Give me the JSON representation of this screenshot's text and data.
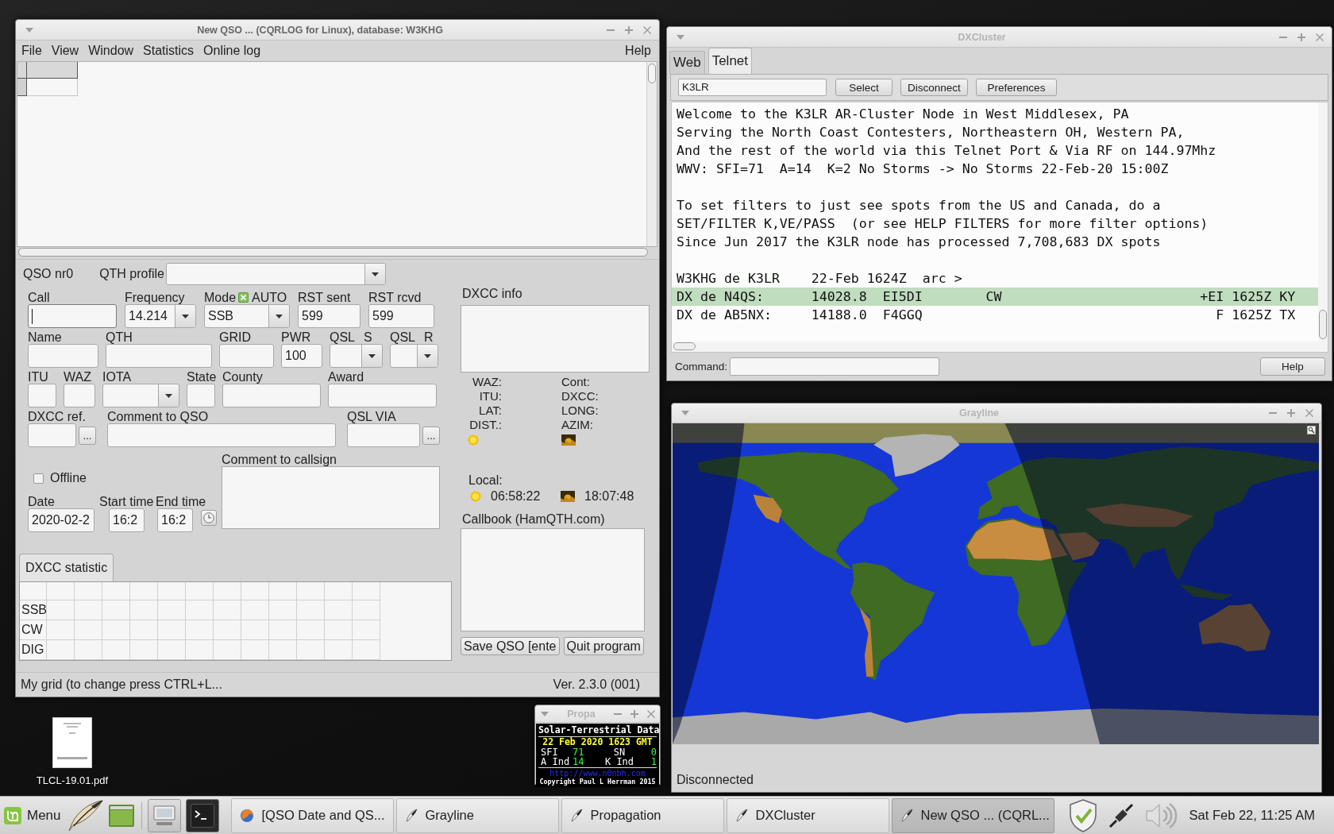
{
  "qso_window": {
    "title": "New QSO ... (CQRLOG for Linux), database: W3KHG",
    "active": true,
    "menu": [
      "File",
      "View",
      "Window",
      "Statistics",
      "Online log"
    ],
    "help_menu": "Help",
    "form": {
      "qso_number": "QSO nr0",
      "qth_profile": {
        "label": "QTH profile"
      },
      "field_rows": [
        [
          {
            "kind": "text",
            "label": "Call",
            "focused": true
          },
          {
            "kind": "dropdown",
            "label": "Frequency",
            "value": "14.214",
            "focused": false
          },
          {
            "kind": "dropdown",
            "label": "Mode",
            "value": "SSB",
            "focused": false,
            "option": {
              "label": "AUTO",
              "checked": true
            }
          },
          {
            "kind": "text",
            "label": "RST sent",
            "value": "599",
            "focused": false
          },
          {
            "kind": "text",
            "label": "RST rcvd",
            "value": "599",
            "focused": false
          }
        ],
        [
          {
            "kind": "text",
            "label": "Name",
            "focused": false
          },
          {
            "kind": "text",
            "label": "QTH",
            "focused": false
          },
          {
            "kind": "text",
            "label": "GRID",
            "focused": false
          },
          {
            "kind": "text",
            "label": "PWR",
            "value": "100",
            "focused": false
          },
          {
            "kind": "dropdown",
            "label": "QSL",
            "side_label": "S",
            "focused": false
          },
          {
            "kind": "dropdown",
            "label": "QSL",
            "side_label": "R",
            "focused": false
          }
        ],
        [
          {
            "kind": "text",
            "label": "ITU",
            "focused": false
          },
          {
            "kind": "text",
            "label": "WAZ",
            "focused": false
          },
          {
            "kind": "dropdown",
            "label": "IOTA",
            "focused": false
          },
          {
            "kind": "text",
            "label": "State",
            "focused": false
          },
          {
            "kind": "text",
            "label": "County",
            "focused": false
          },
          {
            "kind": "text",
            "label": "Award",
            "focused": false
          }
        ],
        [
          {
            "kind": "text_button",
            "label": "DXCC ref.",
            "button": "...",
            "focused": false
          },
          {
            "kind": "text",
            "label": "Comment to QSO",
            "focused": false
          },
          {
            "kind": "text_button",
            "label": "QSL VIA",
            "button": "...",
            "focused": false
          }
        ]
      ],
      "offline": {
        "label": "Offline",
        "checked": false
      },
      "times": [
        {
          "label": "Date",
          "value": "2020-02-2"
        },
        {
          "label": "Start time",
          "value": "16:2"
        },
        {
          "label": "End time",
          "value": "16:2"
        }
      ],
      "comment_to_callsign": {
        "label": "Comment to callsign"
      },
      "dxcc_info": {
        "label": "DXCC info",
        "left_labels": [
          "WAZ:",
          "ITU:",
          "LAT:",
          "DIST.:"
        ],
        "right_labels": [
          "Cont:",
          "DXCC:",
          "LONG:",
          "AZIM:"
        ]
      },
      "local": {
        "label": "Local:",
        "sunrise": "06:58:22",
        "sunset": "18:07:48"
      },
      "callbook": {
        "label": "Callbook (HamQTH.com)"
      },
      "buttons": [
        "Save QSO [ente",
        "Quit program"
      ],
      "statistics": {
        "tabs": [
          {
            "label": "DXCC statistic",
            "selected": true
          }
        ],
        "row_labels": [
          "SSB",
          "CW",
          "DIG"
        ]
      }
    },
    "status_bar": {
      "left": "My grid (to change press CTRL+L...",
      "right": "Ver. 2.3.0 (001)"
    }
  },
  "dxcluster_window": {
    "title": "DXCluster",
    "active": false,
    "tabs": [
      {
        "label": "Web",
        "selected": false
      },
      {
        "label": "Telnet",
        "selected": true
      }
    ],
    "host": {
      "value": "K3LR"
    },
    "toolbar_buttons": [
      "Select",
      "Disconnect",
      "Preferences"
    ],
    "console": {
      "blocks": [
        {
          "lines": [
            {
              "text": "Welcome to the K3LR AR-Cluster Node in West Middlesex, PA",
              "selected": false
            },
            {
              "text": "Serving the North Coast Contesters, Northeastern OH, Western PA,",
              "selected": false
            },
            {
              "text": "And the rest of the world via this Telnet Port & Via RF on 144.97Mhz",
              "selected": false
            },
            {
              "text": "WWV: SFI=71  A=14  K=2 No Storms -> No Storms 22-Feb-20 15:00Z",
              "selected": false
            }
          ]
        },
        {
          "lines": [
            {
              "text": "To set filters to just see spots from the US and Canada, do a",
              "selected": false
            },
            {
              "text": "SET/FILTER K,VE/PASS  (or see HELP FILTERS for more filter options)",
              "selected": false
            },
            {
              "text": "Since Jun 2017 the K3LR node has processed 7,708,683 DX spots",
              "selected": false
            }
          ]
        },
        {
          "lines": [
            {
              "text": "W3KHG de K3LR    22-Feb 1624Z  arc >",
              "selected": false
            },
            {
              "text": "DX de N4QS:      14028.8  EI5DI        CW                         +EI 1625Z KY",
              "selected": true
            },
            {
              "text": "DX de AB5NX:     14188.0  F4GGQ                                     F 1625Z TX",
              "selected": false
            }
          ]
        }
      ]
    },
    "command": {
      "label": "Command:"
    },
    "help_button": "Help"
  },
  "grayline_window": {
    "title": "Grayline",
    "active": false,
    "status": "Disconnected"
  },
  "desktop": {
    "files": [
      {
        "label": "TLCL-19.01.pdf"
      }
    ]
  },
  "propagation_window": {
    "title": "Propa",
    "active": false,
    "panel": {
      "heading": "Solar-Terrestrial Data",
      "date": "22 Feb 2020 1623 GMT",
      "readings": [
        [
          {
            "label": "SFI",
            "value": "71"
          },
          {
            "label": "SN",
            "value": "0"
          }
        ],
        [
          {
            "label": "A Ind",
            "value": "14"
          },
          {
            "label": "K Ind",
            "value": "1"
          }
        ]
      ],
      "url": "http://www.n0nbh.com",
      "copyright": "Copyright Paul L Herrman 2015"
    }
  },
  "taskbar": {
    "menu": "Menu",
    "tasks": [
      {
        "kind": "browser",
        "label": "[QSO Date and QS...",
        "selected": false
      },
      {
        "kind": "app",
        "label": "Grayline",
        "selected": false
      },
      {
        "kind": "app",
        "label": "Propagation",
        "selected": false
      },
      {
        "kind": "app",
        "label": "DXCluster",
        "selected": false
      },
      {
        "kind": "app",
        "label": "New QSO ... (CQRL...",
        "selected": true
      }
    ],
    "clock": "Sat Feb 22, 11:25 AM"
  }
}
